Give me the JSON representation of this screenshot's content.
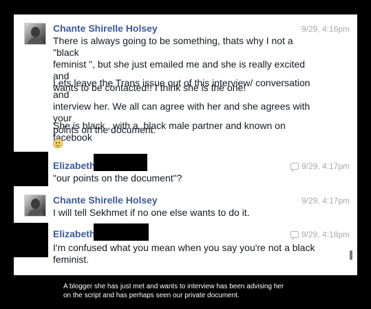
{
  "messages": [
    {
      "sender": "Chante Shirelle Holsey",
      "time": "9/29, 4:16pm",
      "paragraphs": [
        "There is always going to be something, thats why I not a \"black\nfeminist \", but she just emailed me and she is really excited and\nwants to be contacted!! I think she is the one!",
        "Lets.leave the Trans issue out of this interview/ conversation and\ninterview her. We all can agree with her and she agrees with your\npoints on the document.",
        "She is black , with a. black male partner and known on facebook"
      ],
      "emoji": "smiley-emoji"
    },
    {
      "sender": "Elizabeth",
      "time": "9/29, 4:17pm",
      "text": "\"our points on the document\"?"
    },
    {
      "sender": "Chante Shirelle Holsey",
      "time": "9/29, 4:17pm",
      "text": "I will tell Sekhmet if no one else wants to do it."
    },
    {
      "sender": "Elizabeth",
      "time": "9/29, 4:18pm",
      "text": "I'm confused what you mean when you say you're not a black\nfeminist."
    }
  ],
  "caption": "A blogger she has just met and wants to interview has been advising her\non the script and has perhaps seen our private document.",
  "colors": {
    "name": "#3b5998",
    "text": "#141823",
    "time": "#a8a8a8",
    "background": "#000000"
  }
}
